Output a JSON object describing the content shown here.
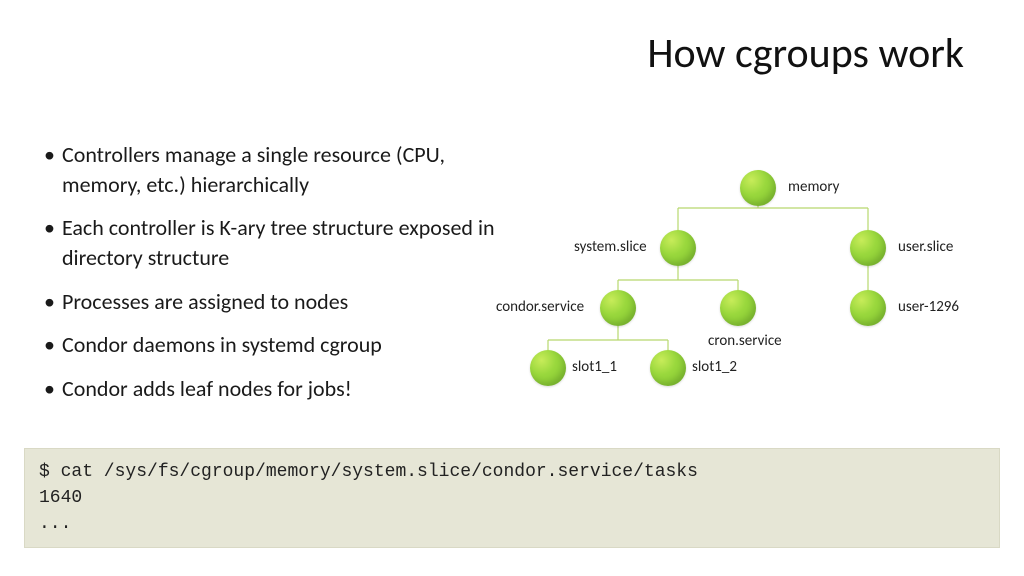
{
  "title": "How cgroups work",
  "bullets": [
    "Controllers manage a single resource (CPU, memory, etc.) hierarchically",
    "Each controller is K-ary tree structure exposed in directory structure",
    "Processes are assigned to nodes",
    "Condor daemons in systemd cgroup",
    "Condor adds leaf nodes for jobs!"
  ],
  "tree": {
    "nodes": {
      "memory": {
        "label": "memory"
      },
      "system_slice": {
        "label": "system.slice"
      },
      "user_slice": {
        "label": "user.slice"
      },
      "condor_service": {
        "label": "condor.service"
      },
      "cron_service": {
        "label": "cron.service"
      },
      "user_1296": {
        "label": "user-1296"
      },
      "slot1_1": {
        "label": "slot1_1"
      },
      "slot1_2": {
        "label": "slot1_2"
      }
    },
    "edges": [
      [
        "memory",
        "system_slice"
      ],
      [
        "memory",
        "user_slice"
      ],
      [
        "system_slice",
        "condor_service"
      ],
      [
        "system_slice",
        "cron_service"
      ],
      [
        "user_slice",
        "user_1296"
      ],
      [
        "condor_service",
        "slot1_1"
      ],
      [
        "condor_service",
        "slot1_2"
      ]
    ]
  },
  "code": "$ cat /sys/fs/cgroup/memory/system.slice/condor.service/tasks\n1640\n..."
}
